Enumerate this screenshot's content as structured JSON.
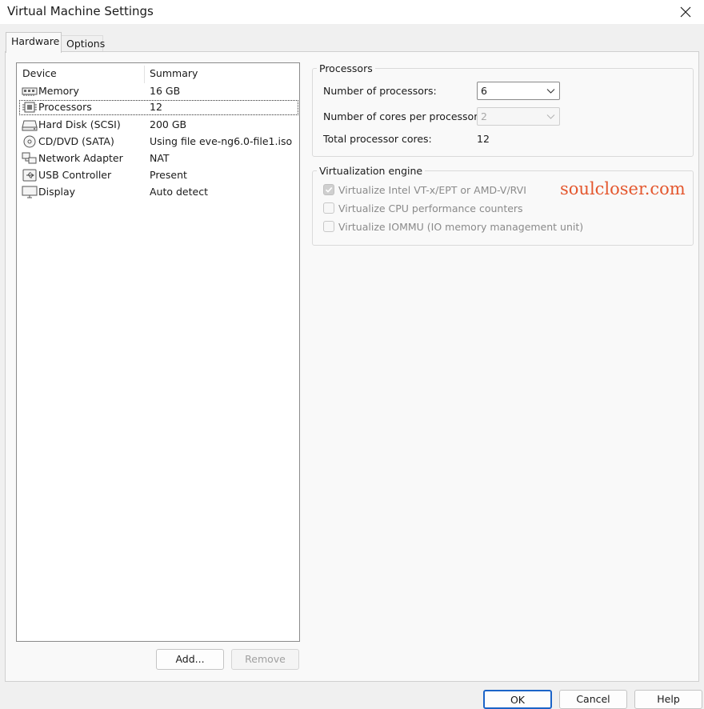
{
  "window": {
    "title": "Virtual Machine Settings",
    "close_icon": "close-icon"
  },
  "tabs": [
    {
      "label": "Hardware",
      "active": true
    },
    {
      "label": "Options",
      "active": false
    }
  ],
  "device_list": {
    "columns": {
      "device": "Device",
      "summary": "Summary"
    },
    "rows": [
      {
        "icon": "memory-icon",
        "device": "Memory",
        "summary": "16 GB"
      },
      {
        "icon": "processor-icon",
        "device": "Processors",
        "summary": "12",
        "selected": true
      },
      {
        "icon": "hard-disk-icon",
        "device": "Hard Disk (SCSI)",
        "summary": "200 GB"
      },
      {
        "icon": "cd-dvd-icon",
        "device": "CD/DVD (SATA)",
        "summary": "Using file eve-ng6.0-file1.iso"
      },
      {
        "icon": "network-adapter-icon",
        "device": "Network Adapter",
        "summary": "NAT"
      },
      {
        "icon": "usb-icon",
        "device": "USB Controller",
        "summary": "Present"
      },
      {
        "icon": "display-icon",
        "device": "Display",
        "summary": "Auto detect"
      }
    ]
  },
  "list_buttons": {
    "add": "Add...",
    "remove": "Remove"
  },
  "processors": {
    "legend": "Processors",
    "num_processors_label": "Number of processors:",
    "num_processors_value": "6",
    "cores_label": "Number of cores per processor:",
    "cores_value": "2",
    "total_label": "Total processor cores:",
    "total_value": "12"
  },
  "virtualization": {
    "legend": "Virtualization engine",
    "options": [
      {
        "label": "Virtualize Intel VT-x/EPT or AMD-V/RVI",
        "checked": true
      },
      {
        "label": "Virtualize CPU performance counters",
        "checked": false
      },
      {
        "label": "Virtualize IOMMU (IO memory management unit)",
        "checked": false
      }
    ]
  },
  "watermark": "soulcloser.com",
  "footer_buttons": {
    "ok": "OK",
    "cancel": "Cancel",
    "help": "Help"
  },
  "colors": {
    "accent": "#1b64c8",
    "watermark": "#e4572e"
  }
}
